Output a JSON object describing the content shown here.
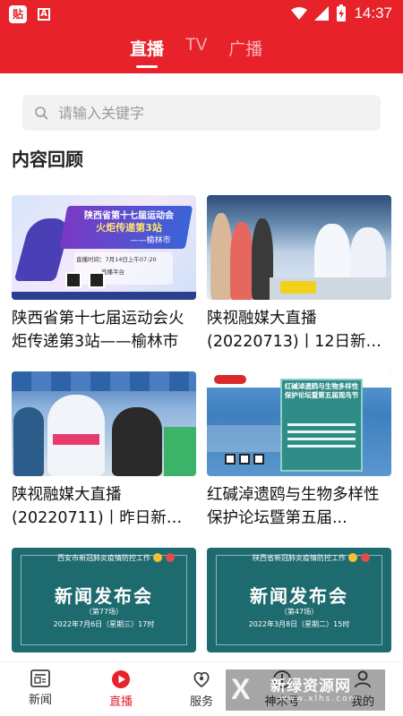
{
  "status_bar": {
    "app_icon_1": "app-badge-icon",
    "app_icon_2": "a-box-icon",
    "time": "14:37",
    "icons": [
      "wifi-icon",
      "signal-icon",
      "battery-charging-icon"
    ]
  },
  "top_tabs": [
    {
      "label": "直播",
      "active": true
    },
    {
      "label": "TV",
      "active": false
    },
    {
      "label": "广播",
      "active": false
    }
  ],
  "search": {
    "placeholder": "请输入关键字",
    "value": ""
  },
  "section": {
    "title": "内容回顾"
  },
  "cards": [
    {
      "title": "陕西省第十七届运动会火炬传递第3站——榆林市",
      "thumb": {
        "headline": "陕西省第十七届运动会",
        "subline": "火炬传递第3站",
        "place": "——榆林市",
        "time_line": "直播时间：7月14日上午07:20",
        "platform": "直播平台"
      }
    },
    {
      "title": "陕视融媒大直播(20220713)丨12日新增...",
      "thumb": {}
    },
    {
      "title": "陕视融媒大直播(20220711)丨昨日新增...",
      "thumb": {}
    },
    {
      "title": "红碱淖遗鸥与生物多样性保护论坛暨第五届...",
      "thumb": {
        "board_title": "红碱淖遗鸥与生物多样性保护论坛暨第五届观鸟节"
      }
    },
    {
      "title": "",
      "thumb": {
        "org": "西安市新冠肺炎疫情防控工作",
        "headline": "新闻发布会",
        "number": "（第77场）",
        "date": "2022年7月6日（星期三）17时"
      }
    },
    {
      "title": "",
      "thumb": {
        "org": "陕西省新冠肺炎疫情防控工作",
        "headline": "新闻发布会",
        "number": "（第47场）",
        "date": "2022年3月8日（星期二）15时"
      }
    }
  ],
  "bottom_nav": [
    {
      "label": "新闻",
      "icon": "news-icon",
      "active": false
    },
    {
      "label": "直播",
      "icon": "play-circle-icon",
      "active": true
    },
    {
      "label": "服务",
      "icon": "service-heart-icon",
      "active": false
    },
    {
      "label": "神木号",
      "icon": "shenmu-icon",
      "active": false
    },
    {
      "label": "我的",
      "icon": "profile-icon",
      "active": false
    }
  ],
  "watermark": {
    "brand": "新绿资源网",
    "url": "www.xlhs.com"
  },
  "colors": {
    "brand_red": "#e8222b",
    "teal_board": "#1e6b6f"
  }
}
